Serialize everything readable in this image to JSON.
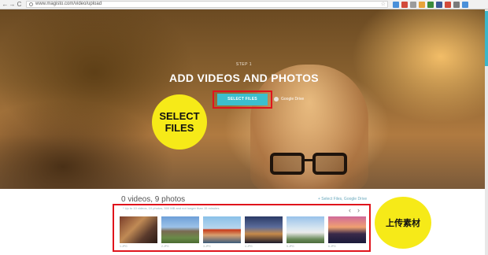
{
  "browser": {
    "url": "www.magisto.com/video/upload",
    "nav": {
      "back": "←",
      "forward": "→",
      "reload": "C"
    },
    "star": "☆",
    "extension_colors": [
      "#4a90d9",
      "#d24a3a",
      "#9b9b9b",
      "#e8a33a",
      "#3a8a3a",
      "#3b5998",
      "#d24a3a",
      "#7a7a7a",
      "#4a90d9"
    ]
  },
  "hero": {
    "step": "STEP 1",
    "title": "ADD VIDEOS AND PHOTOS",
    "select_button": "SELECT FILES",
    "gdrive_label": "Google Drive"
  },
  "callouts": {
    "select_files_line1": "SELECT",
    "select_files_line2": "FILES",
    "upload_material": "上传素材"
  },
  "upload": {
    "count": "0 videos, 9 photos",
    "links": "+ Select Files, Google Drive",
    "note": "* Up to 10 videos, 10 photos, 500 MB and not longer than 15 minutes",
    "prev": "‹",
    "next": "›",
    "thumbnails": [
      {
        "caption": "1.JPG"
      },
      {
        "caption": "2.JPG"
      },
      {
        "caption": "3.JPG"
      },
      {
        "caption": "4.JPG"
      },
      {
        "caption": "5.JPG"
      },
      {
        "caption": "6.JPG"
      }
    ]
  },
  "colors": {
    "accent": "#3cbfcd",
    "annotation_red": "#e0141c",
    "callout_yellow": "#f6ea18"
  }
}
